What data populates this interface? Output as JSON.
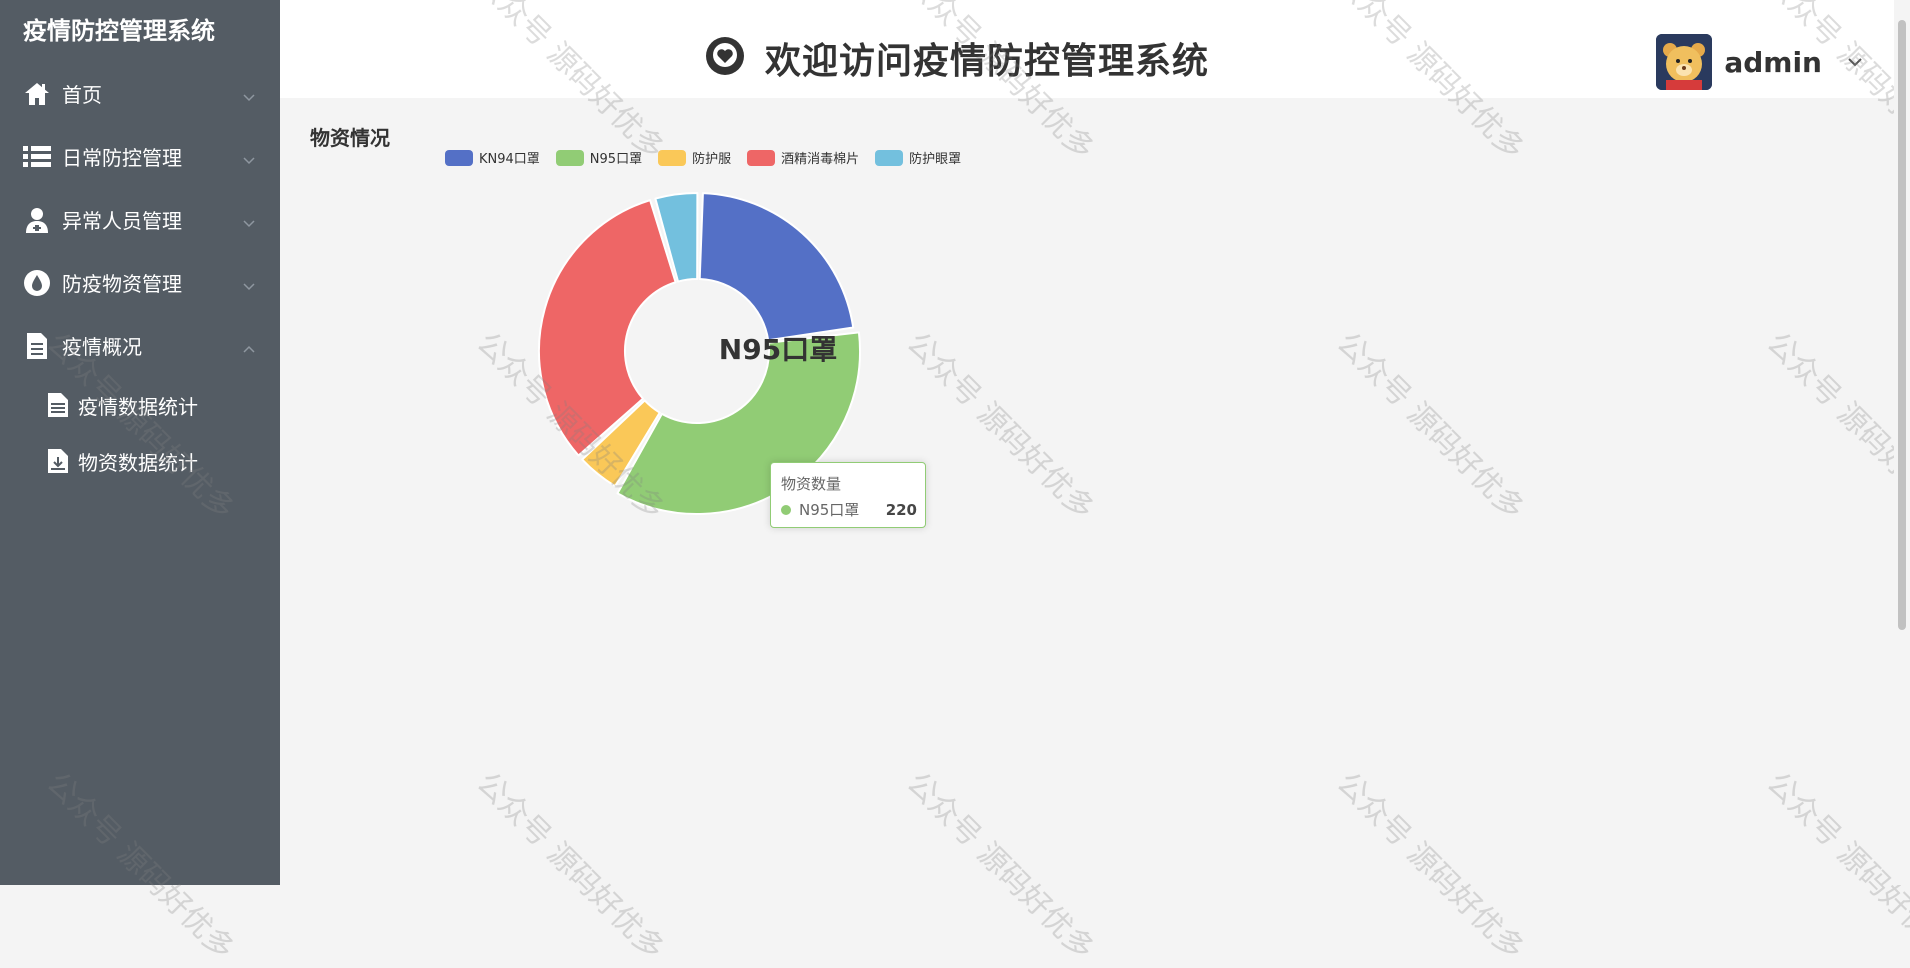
{
  "sidebar": {
    "brand": "疫情防控管理系统",
    "items": [
      {
        "label": "首页",
        "icon": "home-icon"
      },
      {
        "label": "日常防控管理",
        "icon": "list-icon"
      },
      {
        "label": "异常人员管理",
        "icon": "user-nurse-icon"
      },
      {
        "label": "防疫物资管理",
        "icon": "drop-icon"
      },
      {
        "label": "疫情概况",
        "icon": "document-icon",
        "expanded": true
      }
    ],
    "subitems": [
      {
        "label": "疫情数据统计",
        "icon": "file-chart-icon"
      },
      {
        "label": "物资数据统计",
        "icon": "file-download-icon"
      }
    ]
  },
  "header": {
    "title": "欢迎访问疫情防控管理系统",
    "user": "admin"
  },
  "content": {
    "section_title": "物资情况"
  },
  "watermark": "公众号 源码好优多",
  "chart_data": {
    "type": "pie",
    "donut": true,
    "legend": [
      "KN94口罩",
      "N95口罩",
      "防护服",
      "酒精消毒棉片",
      "防护眼罩"
    ],
    "series": [
      {
        "name": "物资数量",
        "data": [
          {
            "name": "KN94口罩",
            "value": 140,
            "color": "#5470c6"
          },
          {
            "name": "N95口罩",
            "value": 220,
            "color": "#91cc75"
          },
          {
            "name": "防护服",
            "value": 30,
            "color": "#fac858"
          },
          {
            "name": "酒精消毒棉片",
            "value": 200,
            "color": "#ee6666"
          },
          {
            "name": "防护眼罩",
            "value": 30,
            "color": "#73c0de"
          }
        ]
      }
    ],
    "center_label": "N95口罩",
    "tooltip": {
      "title": "物资数量",
      "name": "N95口罩",
      "value": "220"
    },
    "legend_position": "top"
  },
  "colors": {
    "sidebar_bg": "#545c64",
    "header_bg": "#ffffff",
    "content_bg": "#f4f4f4"
  }
}
